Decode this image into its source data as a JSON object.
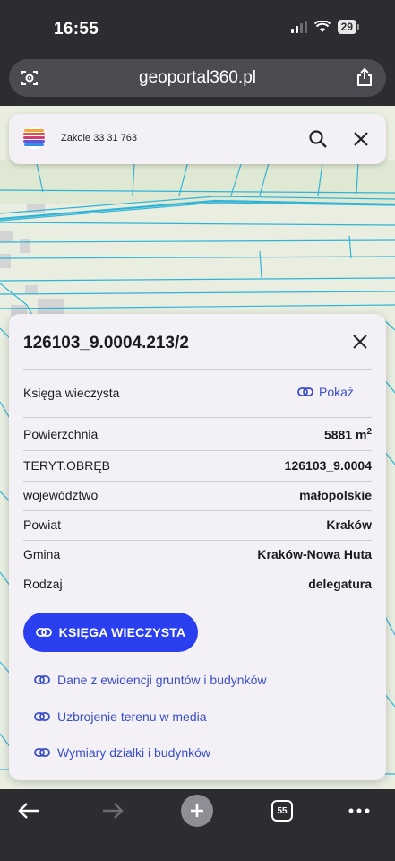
{
  "status_bar": {
    "time": "16:55",
    "battery": "29"
  },
  "browser": {
    "url": "geoportal360.pl",
    "left_icon": "reader-icon",
    "right_icon": "share-icon"
  },
  "search": {
    "query": "Zakole 33 31 763",
    "logo": "geoportal-logo",
    "search_icon": "search-icon",
    "close_icon": "close-icon"
  },
  "panel": {
    "title": "126103_9.0004.213/2",
    "land_registry": {
      "label": "Księga wieczysta",
      "link": "Pokaż"
    },
    "rows": [
      {
        "label": "Powierzchnia",
        "value": "5881 m",
        "sup": "2"
      },
      {
        "label": "TERYT.OBRĘB",
        "value": "126103_9.0004"
      },
      {
        "label": "województwo",
        "value": "małopolskie"
      },
      {
        "label": "Powiat",
        "value": "Kraków"
      },
      {
        "label": "Gmina",
        "value": "Kraków-Nowa Huta"
      },
      {
        "label": "Rodzaj",
        "value": "delegatura"
      }
    ],
    "primary_button": "KSIĘGA WIECZYSTA",
    "links": [
      "Dane z ewidencji gruntów i budynków",
      "Uzbrojenie terenu w media",
      "Wymiary działki i budynków"
    ]
  },
  "bottom_bar": {
    "tabs_count": "55"
  },
  "colors": {
    "accent": "#2a40f0",
    "link": "#3a4ec7",
    "map_bg": "#e9eee1",
    "parcel_line": "#2fb4d8",
    "chrome": "#2b2d31"
  }
}
